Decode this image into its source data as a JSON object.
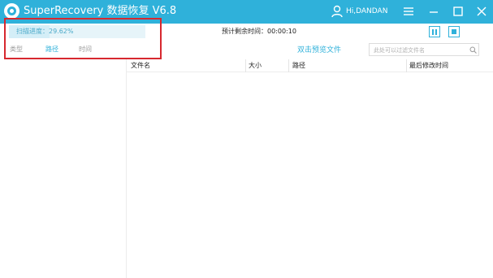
{
  "window": {
    "title": "SuperRecovery 数据恢复 V6.8",
    "user": "Hi,DANDAN",
    "accent_color": "#2fb1da",
    "icons": [
      "app-logo-icon",
      "user-icon",
      "menu-icon",
      "minimize-icon",
      "maximize-icon",
      "close-icon"
    ]
  },
  "scan": {
    "progress_label": "扫描进度：29.62%",
    "progress_percent": 29.62,
    "remaining_time": "预计剩余时间：00:00:10",
    "pause_icon": "pause-icon",
    "stop_icon": "stop-icon"
  },
  "tabs": {
    "items": [
      {
        "label": "类型"
      },
      {
        "label": "路径"
      },
      {
        "label": "时间"
      }
    ],
    "active_index": 1
  },
  "toolbar": {
    "preview_link": "双击预览文件",
    "search_placeholder": "此处可以过滤文件名",
    "search_icon": "search-icon"
  },
  "table": {
    "columns": [
      {
        "label": "文件名"
      },
      {
        "label": "大小"
      },
      {
        "label": "路径"
      },
      {
        "label": "最后修改时间"
      }
    ],
    "rows": []
  },
  "annotation": {
    "highlight_color": "#d7282f"
  }
}
